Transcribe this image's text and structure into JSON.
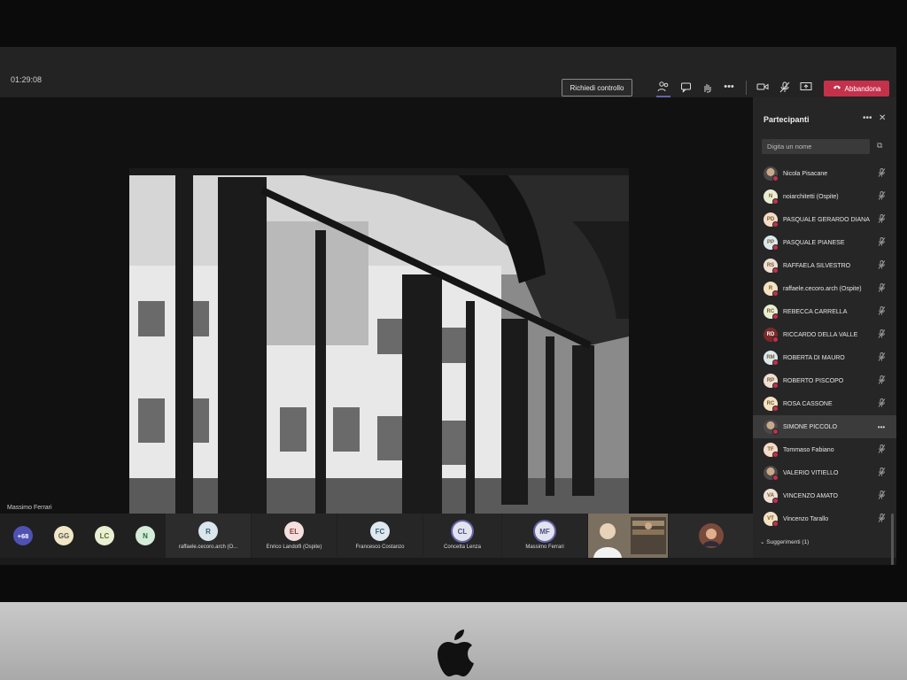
{
  "meeting": {
    "timer": "01:29:08",
    "request_control": "Richiedi controllo",
    "leave": "Abbandona",
    "presenter": "Massimo Ferrari"
  },
  "icons": [
    "participants-icon",
    "chat-icon",
    "raise-hand-icon",
    "more-icon",
    "camera-icon",
    "mic-off-icon",
    "share-icon",
    "phone-icon"
  ],
  "colors": {
    "leave": "#c4314b",
    "accent": "#6264a7",
    "panel": "#262626"
  },
  "strip": {
    "overflow": "+68",
    "avatars": [
      {
        "initials": "GG"
      },
      {
        "initials": "LC"
      },
      {
        "initials": "N"
      }
    ],
    "tiles": [
      {
        "initials": "R",
        "label": "raffaele.cecoro.arch (O..."
      },
      {
        "initials": "EL",
        "label": "Enrico Landolfi (Ospite)"
      },
      {
        "initials": "FC",
        "label": "Francesco Costanzo"
      },
      {
        "initials": "CL",
        "label": "Concetta Lenza"
      },
      {
        "initials": "MF",
        "label": "Massimo Ferrari"
      }
    ]
  },
  "panel": {
    "title": "Partecipanti",
    "search_placeholder": "Digita un nome",
    "suggestions": "Suggerimenti (1)",
    "participants": [
      {
        "initials": "",
        "name": "Nicola Pisacane",
        "photo": true
      },
      {
        "initials": "N",
        "name": "noiarchitetti (Ospite)"
      },
      {
        "initials": "PD",
        "name": "PASQUALE GERARDO DIANA"
      },
      {
        "initials": "PP",
        "name": "PASQUALE PIANESE"
      },
      {
        "initials": "RS",
        "name": "RAFFAELA SILVESTRO"
      },
      {
        "initials": "R",
        "name": "raffaele.cecoro.arch (Ospite)"
      },
      {
        "initials": "RC",
        "name": "REBECCA CARRELLA"
      },
      {
        "initials": "RD",
        "name": "RICCARDO DELLA VALLE",
        "dark": true
      },
      {
        "initials": "RM",
        "name": "ROBERTA DI MAURO"
      },
      {
        "initials": "RP",
        "name": "ROBERTO PISCOPO"
      },
      {
        "initials": "RC",
        "name": "ROSA CASSONE"
      },
      {
        "initials": "",
        "name": "SIMONE PICCOLO",
        "photo": true,
        "selected": true
      },
      {
        "initials": "TF",
        "name": "Tommaso Fabiano"
      },
      {
        "initials": "",
        "name": "VALERIO VITIELLO",
        "photo": true
      },
      {
        "initials": "VA",
        "name": "VINCENZO AMATO"
      },
      {
        "initials": "VT",
        "name": "Vincenzo Tarallo"
      }
    ]
  }
}
